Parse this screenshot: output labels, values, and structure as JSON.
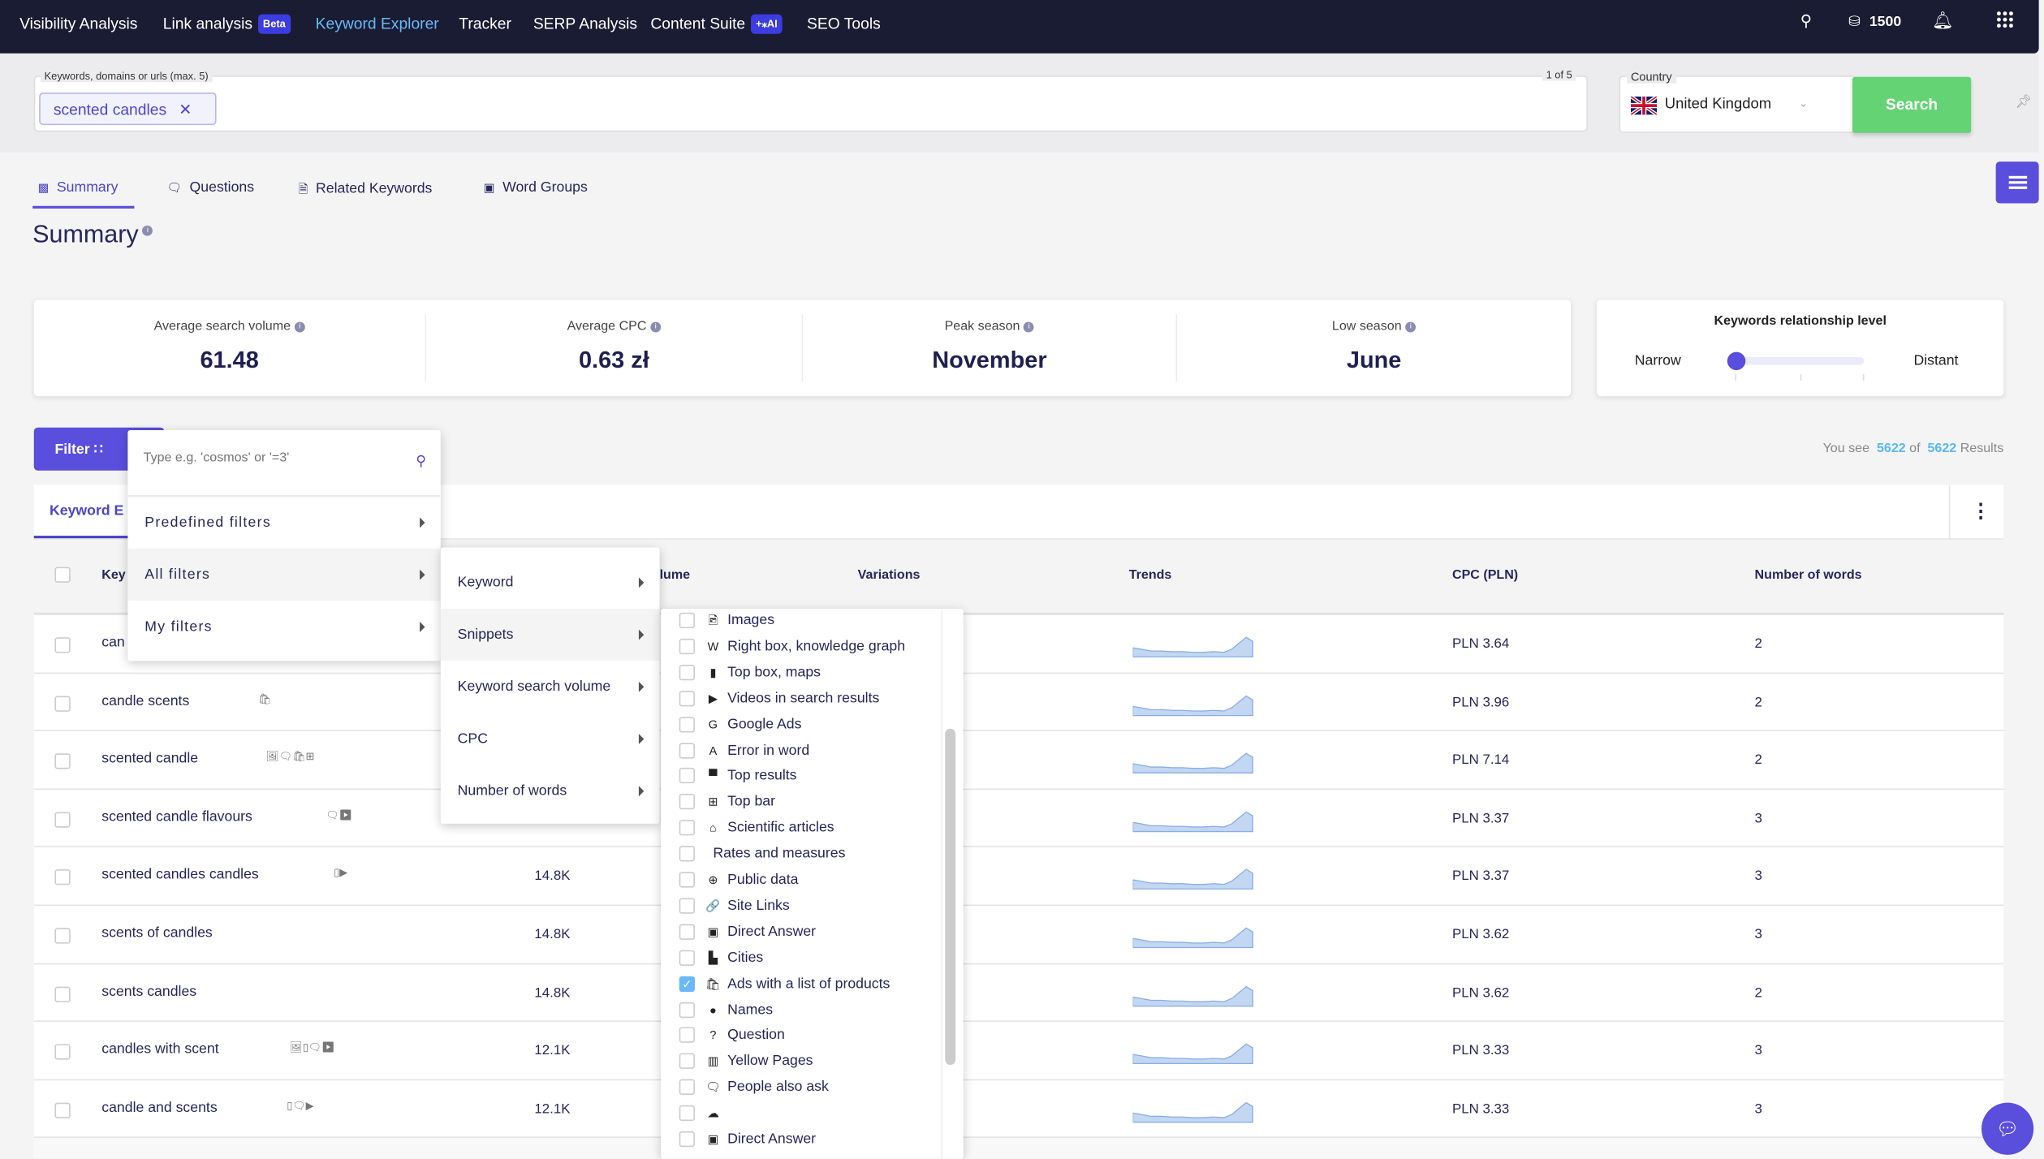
{
  "nav": {
    "items": [
      {
        "label": "Visibility Analysis"
      },
      {
        "label": "Link analysis",
        "badge": "Beta"
      },
      {
        "label": "Keyword Explorer",
        "active": true
      },
      {
        "label": "Tracker"
      },
      {
        "label": "SERP Analysis"
      },
      {
        "label": "Content Suite",
        "badge": "+⁎AI"
      },
      {
        "label": "SEO Tools"
      }
    ],
    "credits": "1500"
  },
  "search": {
    "field_label": "Keywords, domains or urls (max. 5)",
    "counter": "1 of 5",
    "chip": "scented candles",
    "country_label": "Country",
    "country": "United Kingdom",
    "button": "Search"
  },
  "tabs": [
    {
      "label": "Summary",
      "icon": "grid-icon"
    },
    {
      "label": "Questions",
      "icon": "question-icon"
    },
    {
      "label": "Related Keywords",
      "icon": "document-icon"
    },
    {
      "label": "Word Groups",
      "icon": "group-icon"
    }
  ],
  "page_title": "Summary",
  "stats": [
    {
      "title": "Average search volume",
      "value": "61.48"
    },
    {
      "title": "Average CPC",
      "value": "0.63 zł"
    },
    {
      "title": "Peak season",
      "value": "November"
    },
    {
      "title": "Low season",
      "value": "June"
    }
  ],
  "relationship": {
    "title": "Keywords relationship level",
    "left": "Narrow",
    "right": "Distant",
    "level": 0
  },
  "filter_button": "Filter",
  "results": {
    "prefix": "You see",
    "shown": "5622",
    "of": "of",
    "total": "5622",
    "suffix": "Results"
  },
  "table": {
    "tab": "Keyword E",
    "headers": {
      "keyword": "Key",
      "volume": "lume",
      "variations": "Variations",
      "trends": "Trends",
      "cpc": "CPC (PLN)",
      "words": "Number of words"
    },
    "rows": [
      {
        "keyword": "can",
        "icons": "",
        "volume": "",
        "cpc": "PLN 3.64",
        "words": "2"
      },
      {
        "keyword": "candle scents",
        "icons": "🛍",
        "volume": "",
        "cpc": "PLN 3.96",
        "words": "2"
      },
      {
        "keyword": "scented candle",
        "icons": "🖼🗨🛍⊞",
        "volume": "",
        "cpc": "PLN 7.14",
        "words": "2"
      },
      {
        "keyword": "scented candle flavours",
        "icons": "🗨▶",
        "volume": "",
        "cpc": "PLN 3.37",
        "words": "3"
      },
      {
        "keyword": "scented candles candles",
        "icons": "▯▶",
        "volume": "14.8K",
        "cpc": "PLN 3.37",
        "words": "3"
      },
      {
        "keyword": "scents of candles",
        "icons": "",
        "volume": "14.8K",
        "cpc": "PLN 3.62",
        "words": "3"
      },
      {
        "keyword": "scents candles",
        "icons": "",
        "volume": "14.8K",
        "cpc": "PLN 3.62",
        "words": "2"
      },
      {
        "keyword": "candles with scent",
        "icons": "🖼▯🗨▶",
        "volume": "12.1K",
        "cpc": "PLN 3.33",
        "words": "3"
      },
      {
        "keyword": "candle and scents",
        "icons": "▯🗨▶",
        "volume": "12.1K",
        "cpc": "PLN 3.33",
        "words": "3"
      }
    ]
  },
  "filter_menu": {
    "placeholder": "Type e.g. 'cosmos' or '=3'",
    "items": [
      "Predefined filters",
      "All filters",
      "My filters"
    ]
  },
  "all_filters_menu": {
    "items": [
      "Keyword",
      "Snippets",
      "Keyword search volume",
      "CPC",
      "Number of words"
    ]
  },
  "snippets_menu": {
    "items": [
      {
        "label": "Images",
        "icon": "🖻",
        "checked": false
      },
      {
        "label": "Right box, knowledge graph",
        "icon": "W",
        "checked": false
      },
      {
        "label": "Top box, maps",
        "icon": "▮",
        "checked": false
      },
      {
        "label": "Videos in search results",
        "icon": "▶",
        "checked": false
      },
      {
        "label": "Google Ads",
        "icon": "G",
        "checked": false
      },
      {
        "label": "Error in word",
        "icon": "A",
        "checked": false
      },
      {
        "label": "Top results",
        "icon": "▀",
        "checked": false
      },
      {
        "label": "Top bar",
        "icon": "⊞",
        "checked": false
      },
      {
        "label": "Scientific articles",
        "icon": "⌂",
        "checked": false
      },
      {
        "label": "Rates and measures",
        "icon": "",
        "checked": false
      },
      {
        "label": "Public data",
        "icon": "⊕",
        "checked": false
      },
      {
        "label": "Site Links",
        "icon": "🔗",
        "checked": false
      },
      {
        "label": "Direct Answer",
        "icon": "▣",
        "checked": false
      },
      {
        "label": "Cities",
        "icon": "▙",
        "checked": false
      },
      {
        "label": "Ads with a list of products",
        "icon": "🛍",
        "checked": true
      },
      {
        "label": "Names",
        "icon": "●",
        "checked": false
      },
      {
        "label": "Question",
        "icon": "?",
        "checked": false
      },
      {
        "label": "Yellow Pages",
        "icon": "▥",
        "checked": false
      },
      {
        "label": "People also ask",
        "icon": "🗨",
        "checked": false
      },
      {
        "label": "",
        "icon": "☁",
        "checked": false
      },
      {
        "label": "Direct Answer",
        "icon": "▣",
        "checked": false
      }
    ]
  },
  "colors": {
    "nav_bg": "#1a1c33",
    "accent": "#5a4fdc",
    "search_button": "#64d373",
    "link": "#5ab8f0",
    "active_nav": "#6ab8f7"
  }
}
